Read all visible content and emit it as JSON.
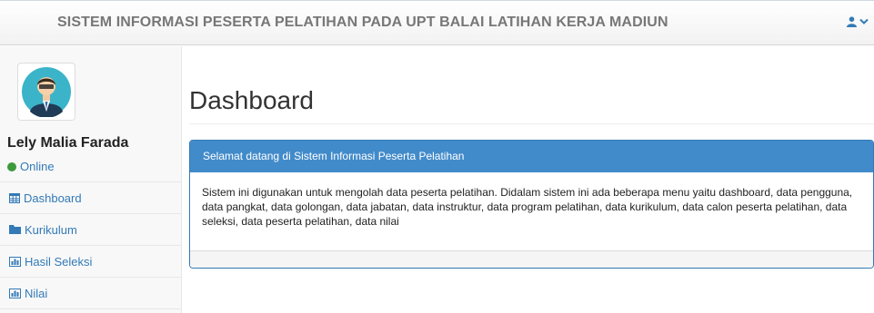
{
  "header": {
    "title": "SISTEM INFORMASI PESERTA PELATIHAN PADA UPT BALAI LATIHAN KERJA MADIUN",
    "user_icon": "user-icon",
    "caret_icon": "chevron-down-icon"
  },
  "sidebar": {
    "user": {
      "name": "Lely Malia Farada",
      "status": "Online"
    },
    "items": [
      {
        "label": "Dashboard",
        "icon": "table-icon"
      },
      {
        "label": "Kurikulum",
        "icon": "folder-icon"
      },
      {
        "label": "Hasil Seleksi",
        "icon": "bar-chart-icon"
      },
      {
        "label": "Nilai",
        "icon": "bar-chart-icon"
      }
    ]
  },
  "main": {
    "title": "Dashboard",
    "panel": {
      "heading": "Selamat datang di Sistem Informasi Peserta Pelatihan",
      "body": "Sistem ini digunakan untuk mengolah data peserta pelatihan. Didalam sistem ini ada beberapa menu yaitu dashboard, data pengguna, data pangkat, data golongan, data jabatan, data instruktur, data program pelatihan, data kurikulum, data calon peserta pelatihan, data seleksi, data peserta pelatihan, data nilai"
    }
  },
  "colors": {
    "primary": "#337ab7",
    "panel_heading": "#428bca",
    "online": "#3c9a3c"
  }
}
